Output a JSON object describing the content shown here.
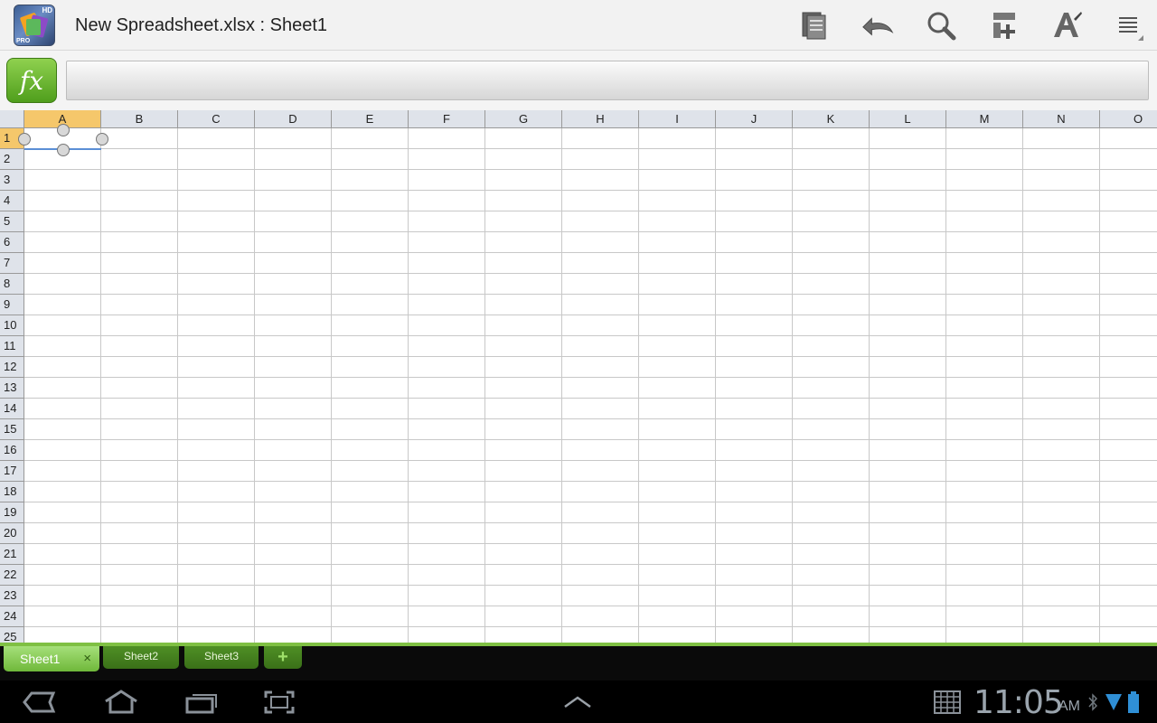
{
  "titlebar": {
    "app_badge_hd": "HD",
    "app_badge_pro": "PRO",
    "document_title": "New Spreadsheet.xlsx : Sheet1",
    "icons": [
      "document-pages-icon",
      "undo-icon",
      "search-icon",
      "insert-icon",
      "format-text-icon",
      "overflow-menu-icon"
    ]
  },
  "formula_bar": {
    "fx_label": "fx",
    "value": ""
  },
  "grid": {
    "columns": [
      "A",
      "B",
      "C",
      "D",
      "E",
      "F",
      "G",
      "H",
      "I",
      "J",
      "K",
      "L",
      "M",
      "N",
      "O"
    ],
    "rows": [
      "1",
      "2",
      "3",
      "4",
      "5",
      "6",
      "7",
      "8",
      "9",
      "10",
      "11",
      "12",
      "13",
      "14",
      "15",
      "16",
      "17",
      "18",
      "19",
      "20",
      "21",
      "22",
      "23",
      "24",
      "25"
    ],
    "selected_cell": "A1",
    "selected_column": "A",
    "selected_row": "1"
  },
  "sheets": {
    "tabs": [
      {
        "label": "Sheet1",
        "active": true
      },
      {
        "label": "Sheet2",
        "active": false
      },
      {
        "label": "Sheet3",
        "active": false
      }
    ],
    "close_glyph": "×",
    "add_glyph": "+"
  },
  "system_bar": {
    "nav_icons": [
      "back-icon",
      "home-icon",
      "recent-apps-icon",
      "screenshot-icon"
    ],
    "time": "11:05",
    "ampm": "AM",
    "status_icons": [
      "keyboard-grid-icon",
      "bluetooth-icon",
      "wifi-icon",
      "battery-icon"
    ]
  },
  "colors": {
    "accent_green": "#7fc043",
    "selected_header": "#f5c76b",
    "selection_line": "#5b8fd6"
  }
}
